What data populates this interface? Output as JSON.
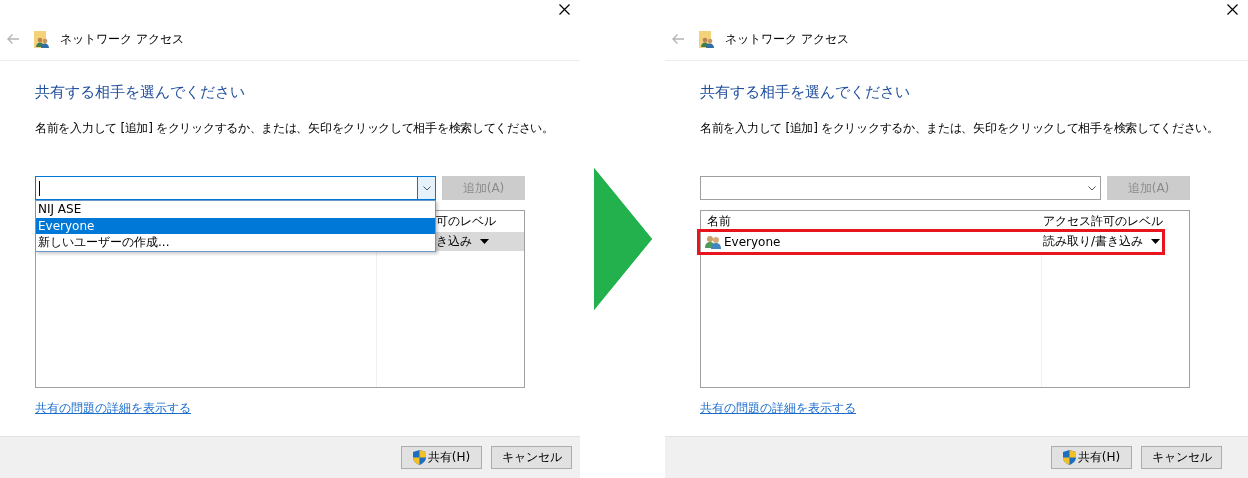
{
  "panels": [
    {
      "title": "ネットワーク アクセス",
      "heading": "共有する相手を選んでください",
      "instruction": "名前を入力して [追加] をクリックするか、または、矢印をクリックして相手を検索してください。",
      "combo": {
        "focused": true,
        "open": true,
        "options": [
          {
            "label": "NIJ ASE",
            "selected": false
          },
          {
            "label": "Everyone",
            "selected": true
          },
          {
            "label": "新しいユーザーの作成...",
            "selected": false
          }
        ]
      },
      "add_button": {
        "label": "追加(A)",
        "disabled": true
      },
      "list": {
        "columns": {
          "access": "可のレベル"
        },
        "rows": [
          {
            "access": "き込み",
            "selected": true,
            "outlined": false
          }
        ]
      },
      "link": "共有の問題の詳細を表示する",
      "buttons": [
        {
          "label": "共有(H)",
          "kind": "shield"
        },
        {
          "label": "キャンセル",
          "kind": "plain"
        }
      ]
    },
    {
      "title": "ネットワーク アクセス",
      "heading": "共有する相手を選んでください",
      "instruction": "名前を入力して [追加] をクリックするか、または、矢印をクリックして相手を検索してください。",
      "combo": {
        "focused": false,
        "open": false
      },
      "add_button": {
        "label": "追加(A)",
        "disabled": true
      },
      "list": {
        "columns": {
          "name": "名前",
          "access": "アクセス許可のレベル"
        },
        "rows": [
          {
            "name": "Everyone",
            "access": "読み取り/書き込み",
            "selected": false,
            "outlined": true
          }
        ]
      },
      "link": "共有の問題の詳細を表示する",
      "buttons": [
        {
          "label": "共有(H)",
          "kind": "shield"
        },
        {
          "label": "キャンセル",
          "kind": "plain"
        }
      ]
    }
  ]
}
